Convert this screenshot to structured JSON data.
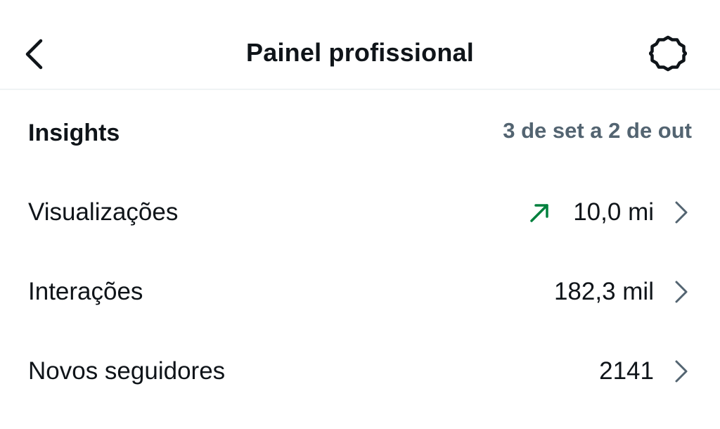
{
  "header": {
    "title": "Painel profissional",
    "back_icon": "chevron-left-icon",
    "settings_icon": "gear-icon"
  },
  "insights": {
    "title": "Insights",
    "date_range": "3 de set a 2 de out"
  },
  "metrics": [
    {
      "label": "Visualizações",
      "value": "10,0 mi",
      "trend": "up",
      "trend_color": "#00803d"
    },
    {
      "label": "Interações",
      "value": "182,3 mil"
    },
    {
      "label": "Novos seguidores",
      "value": "2141"
    }
  ]
}
